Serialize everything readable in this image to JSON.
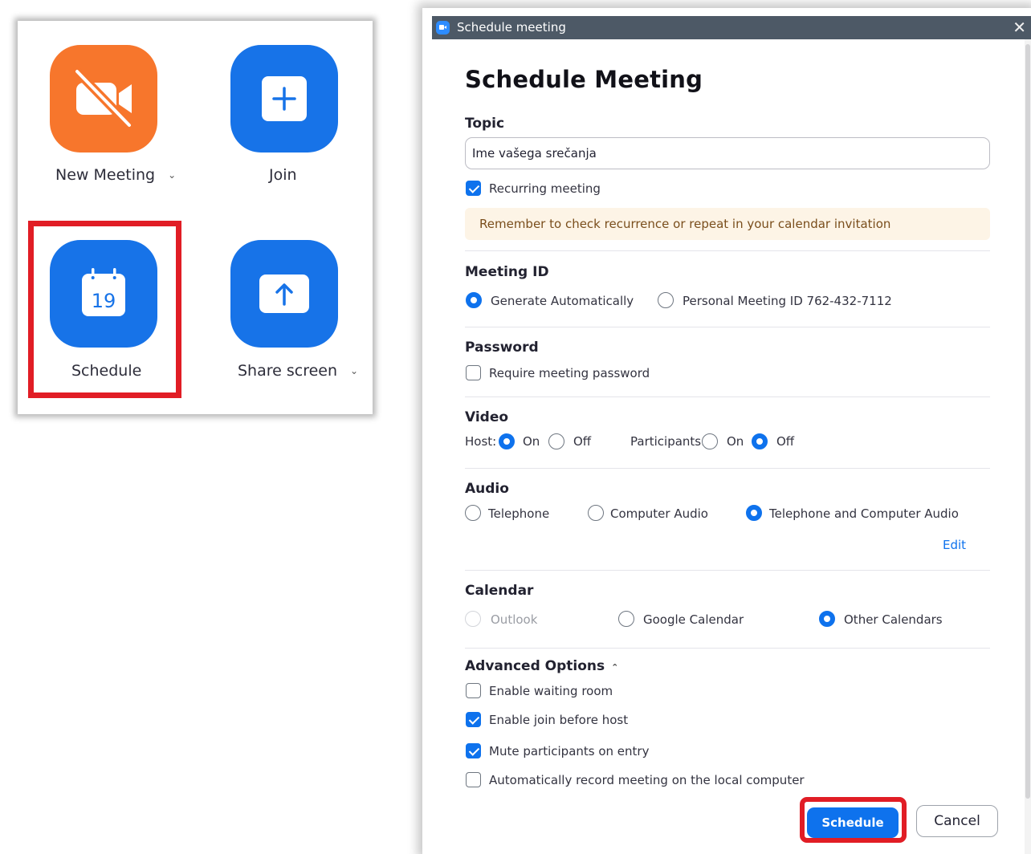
{
  "home": {
    "tiles": [
      {
        "label": "New Meeting",
        "icon": "video-off-icon",
        "color": "#f7762c",
        "has_dropdown": true
      },
      {
        "label": "Join",
        "icon": "plus-icon",
        "color": "#1773e8",
        "has_dropdown": false
      },
      {
        "label": "Schedule",
        "icon": "calendar-icon",
        "color": "#1773e8",
        "calendar_day": "19",
        "highlighted": true
      },
      {
        "label": "Share screen",
        "icon": "share-up-arrow-icon",
        "color": "#1773e8",
        "has_dropdown": true
      }
    ],
    "highlight_color": "#e11d25"
  },
  "dialog": {
    "window_title": "Schedule meeting",
    "heading": "Schedule Meeting",
    "topic": {
      "label": "Topic",
      "value": "Ime vašega srečanja",
      "recurring_label": "Recurring meeting",
      "recurring_checked": true,
      "notice": "Remember to check recurrence or repeat in your calendar invitation"
    },
    "meeting_id": {
      "label": "Meeting ID",
      "generate_label": "Generate Automatically",
      "personal_label": "Personal Meeting ID 762-432-7112",
      "selected": "generate"
    },
    "password": {
      "label": "Password",
      "require_label": "Require meeting password",
      "checked": false
    },
    "video": {
      "label": "Video",
      "host_label": "Host:",
      "participants_label": "Participants:",
      "on_label": "On",
      "off_label": "Off",
      "host": "on",
      "participants": "off"
    },
    "audio": {
      "label": "Audio",
      "telephone_label": "Telephone",
      "computer_label": "Computer Audio",
      "both_label": "Telephone and Computer Audio",
      "selected": "both",
      "edit_label": "Edit"
    },
    "calendar": {
      "label": "Calendar",
      "outlook_label": "Outlook",
      "google_label": "Google Calendar",
      "other_label": "Other Calendars",
      "selected": "other",
      "outlook_disabled": true
    },
    "advanced": {
      "label": "Advanced Options",
      "expanded": true,
      "options": [
        {
          "label": "Enable waiting room",
          "checked": false
        },
        {
          "label": "Enable join before host",
          "checked": true
        },
        {
          "label": "Mute participants on entry",
          "checked": true
        },
        {
          "label": "Automatically record meeting on the local computer",
          "checked": false
        }
      ]
    },
    "buttons": {
      "schedule_label": "Schedule",
      "cancel_label": "Cancel"
    },
    "accent_color": "#0e72ed",
    "titlebar_color": "#4d5966"
  }
}
